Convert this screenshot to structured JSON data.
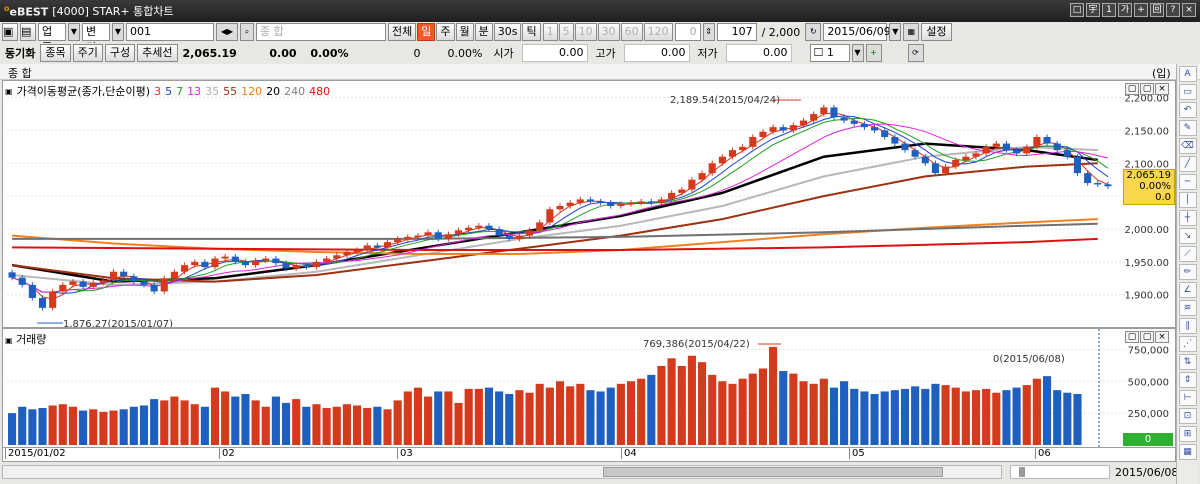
{
  "window": {
    "brand": "eBEST",
    "brand_mark": "o",
    "title": "[4000] STAR+ 통합차트",
    "buttons": [
      "□",
      "宇",
      "1",
      "가",
      "+",
      "回",
      "?",
      "×"
    ]
  },
  "toolbar1": {
    "market": "업종",
    "change": "변경",
    "code": "001",
    "name_placeholder": "종          합",
    "period_buttons": [
      "전체",
      "일",
      "주",
      "월",
      "분",
      "30s",
      "틱"
    ],
    "active_period": "일",
    "interval_buttons": [
      "1",
      "5",
      "10",
      "30",
      "60",
      "120"
    ],
    "count_zero": "0",
    "count": "107",
    "total": "/ 2,000",
    "date": "2015/06/09",
    "settings": "설정"
  },
  "toolbar2": {
    "linked": "동기화",
    "stock": "종목",
    "cycle": "주기",
    "config": "구성",
    "indicator": "추세선",
    "price": "2,065.19",
    "change": "0.00",
    "change_pct": "0.00%",
    "volume": "0",
    "volume_pct": "0.00%",
    "open_label": "시가",
    "open": "0.00",
    "high_label": "고가",
    "high": "0.00",
    "low_label": "저가",
    "low": "0.00",
    "layout_num": "1"
  },
  "subbar": {
    "name": "종          합",
    "unit": "(입)"
  },
  "price_panel": {
    "title": "가격이동평균(종가,단순이평)",
    "ma_periods": [
      {
        "label": "3",
        "color": "#e03020"
      },
      {
        "label": "5",
        "color": "#2040d0"
      },
      {
        "label": "7",
        "color": "#20a020"
      },
      {
        "label": "13",
        "color": "#e020e0"
      },
      {
        "label": "35",
        "color": "#b0b0b0"
      },
      {
        "label": "55",
        "color": "#a03010"
      },
      {
        "label": "120",
        "color": "#f08020"
      },
      {
        "label": "20",
        "color": "#000000"
      },
      {
        "label": "240",
        "color": "#808080"
      },
      {
        "label": "480",
        "color": "#e01010"
      }
    ],
    "high_note": "2,189.54(2015/04/24)",
    "low_note": "1,876.27(2015/01/07)",
    "current_value": "2,065.19",
    "current_pct": "0.00%",
    "current_chg": "0.0",
    "corner_buttons": [
      "▢",
      "▢",
      "×"
    ]
  },
  "volume_panel": {
    "title": "거래량",
    "high_note": "769,386(2015/04/22)",
    "current_note": "0(2015/06/08)",
    "current_badge": "0"
  },
  "x_axis": {
    "labels": [
      "2015/01/02",
      "02",
      "03",
      "04",
      "05",
      "06"
    ],
    "end_date": "2015/06/08"
  },
  "chart_data": [
    {
      "type": "candlestick",
      "title": "가격이동평균(종가,단순이평)",
      "ylim": [
        1860,
        2210
      ],
      "yticks": [
        "2,200.00",
        "2,150.00",
        "2,100.00",
        "2,050.00",
        "2,000.00",
        "1,950.00",
        "1,900.00"
      ],
      "ytick_values": [
        2200,
        2150,
        2100,
        2050,
        2000,
        1950,
        1900
      ],
      "closes": [
        1926,
        1915,
        1895,
        1880,
        1905,
        1915,
        1920,
        1912,
        1918,
        1922,
        1935,
        1928,
        1920,
        1915,
        1905,
        1925,
        1935,
        1945,
        1950,
        1942,
        1955,
        1958,
        1950,
        1945,
        1952,
        1955,
        1948,
        1940,
        1945,
        1942,
        1950,
        1955,
        1960,
        1965,
        1968,
        1975,
        1972,
        1980,
        1985,
        1988,
        1990,
        1995,
        1985,
        1992,
        1998,
        2002,
        2005,
        2000,
        1990,
        1985,
        1990,
        1998,
        2010,
        2030,
        2035,
        2040,
        2045,
        2042,
        2040,
        2035,
        2038,
        2040,
        2042,
        2040,
        2045,
        2055,
        2060,
        2075,
        2085,
        2100,
        2110,
        2120,
        2125,
        2140,
        2148,
        2155,
        2150,
        2158,
        2165,
        2175,
        2185,
        2170,
        2165,
        2160,
        2155,
        2150,
        2140,
        2130,
        2120,
        2110,
        2100,
        2085,
        2095,
        2105,
        2110,
        2115,
        2125,
        2130,
        2120,
        2115,
        2125,
        2140,
        2130,
        2120,
        2110,
        2085,
        2070,
        2068,
        2065
      ],
      "ma_series": [
        {
          "name": "20",
          "color": "#000000",
          "points": [
            [
              0,
              1945
            ],
            [
              10,
              1920
            ],
            [
              20,
              1925
            ],
            [
              30,
              1945
            ],
            [
              40,
              1970
            ],
            [
              50,
              1995
            ],
            [
              60,
              2020
            ],
            [
              70,
              2055
            ],
            [
              80,
              2110
            ],
            [
              90,
              2130
            ],
            [
              100,
              2120
            ],
            [
              107,
              2105
            ]
          ]
        },
        {
          "name": "35",
          "color": "#b8b8b8",
          "points": [
            [
              0,
              1930
            ],
            [
              10,
              1915
            ],
            [
              20,
              1920
            ],
            [
              30,
              1935
            ],
            [
              40,
              1960
            ],
            [
              50,
              1985
            ],
            [
              60,
              2005
            ],
            [
              70,
              2035
            ],
            [
              80,
              2080
            ],
            [
              90,
              2110
            ],
            [
              100,
              2125
            ],
            [
              107,
              2120
            ]
          ]
        },
        {
          "name": "55",
          "color": "#a03010",
          "points": [
            [
              0,
              1945
            ],
            [
              10,
              1925
            ],
            [
              20,
              1920
            ],
            [
              30,
              1930
            ],
            [
              40,
              1950
            ],
            [
              50,
              1970
            ],
            [
              60,
              1990
            ],
            [
              70,
              2015
            ],
            [
              80,
              2050
            ],
            [
              90,
              2080
            ],
            [
              100,
              2095
            ],
            [
              107,
              2100
            ]
          ]
        },
        {
          "name": "120",
          "color": "#f08020",
          "points": [
            [
              0,
              1990
            ],
            [
              10,
              1978
            ],
            [
              20,
              1970
            ],
            [
              30,
              1965
            ],
            [
              40,
              1962
            ],
            [
              50,
              1962
            ],
            [
              60,
              1968
            ],
            [
              70,
              1980
            ],
            [
              80,
              1992
            ],
            [
              90,
              2002
            ],
            [
              100,
              2010
            ],
            [
              107,
              2015
            ]
          ]
        },
        {
          "name": "240",
          "color": "#707070",
          "points": [
            [
              0,
              1985
            ],
            [
              20,
              1985
            ],
            [
              40,
              1985
            ],
            [
              60,
              1988
            ],
            [
              80,
              1995
            ],
            [
              100,
              2005
            ],
            [
              107,
              2008
            ]
          ]
        },
        {
          "name": "480",
          "color": "#e01010",
          "points": [
            [
              0,
              1972
            ],
            [
              20,
              1970
            ],
            [
              40,
              1968
            ],
            [
              60,
              1968
            ],
            [
              80,
              1972
            ],
            [
              100,
              1980
            ],
            [
              107,
              1985
            ]
          ]
        }
      ]
    },
    {
      "type": "bar",
      "title": "거래량",
      "ylim": [
        0,
        800000
      ],
      "yticks": [
        "750,000",
        "500,000",
        "250,000"
      ],
      "ytick_values": [
        750000,
        500000,
        250000
      ],
      "values": [
        250000,
        300000,
        280000,
        290000,
        310000,
        320000,
        300000,
        270000,
        280000,
        260000,
        270000,
        280000,
        300000,
        310000,
        360000,
        350000,
        380000,
        350000,
        320000,
        300000,
        450000,
        420000,
        380000,
        400000,
        350000,
        300000,
        380000,
        330000,
        360000,
        300000,
        320000,
        290000,
        300000,
        320000,
        310000,
        290000,
        300000,
        280000,
        350000,
        420000,
        450000,
        380000,
        420000,
        420000,
        330000,
        440000,
        440000,
        450000,
        420000,
        400000,
        430000,
        410000,
        480000,
        450000,
        500000,
        460000,
        480000,
        430000,
        420000,
        450000,
        480000,
        500000,
        520000,
        550000,
        620000,
        680000,
        620000,
        700000,
        650000,
        550000,
        500000,
        480000,
        520000,
        560000,
        600000,
        769386,
        580000,
        560000,
        500000,
        480000,
        520000,
        450000,
        500000,
        440000,
        420000,
        400000,
        420000,
        430000,
        440000,
        460000,
        440000,
        480000,
        470000,
        450000,
        420000,
        430000,
        440000,
        410000,
        430000,
        450000,
        470000,
        520000,
        540000,
        430000,
        410000,
        400000,
        0
      ],
      "colors_note": "blue=down, red=up"
    }
  ]
}
